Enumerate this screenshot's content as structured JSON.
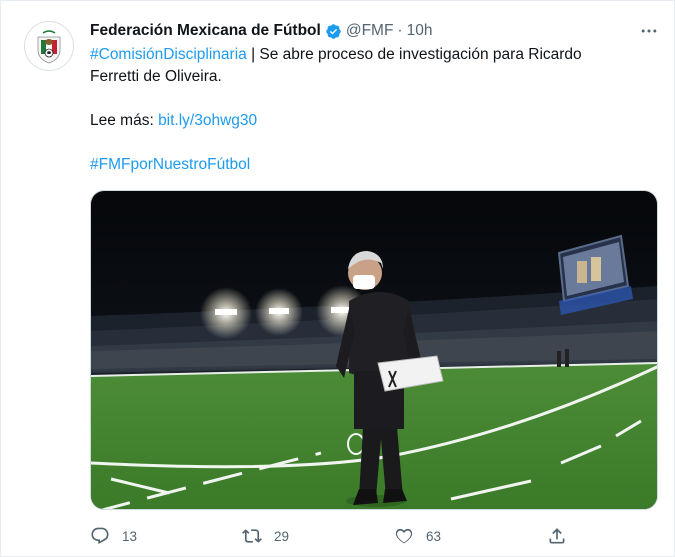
{
  "tweet": {
    "author_name": "Federación Mexicana de Fútbol",
    "handle": "@FMF",
    "separator": "·",
    "time": "10h",
    "text": {
      "hashtag1": "#ComisiónDisciplinaria",
      "line1_rest": " | Se abre proceso de investigación para Ricardo",
      "line2": "Ferretti de Oliveira.",
      "read_more_label": "Lee más: ",
      "link": "bit.ly/3ohwg30",
      "hashtag2": "#FMFporNuestroFútbol"
    },
    "media_description": "Coach in mask walking on the field in a stadium at night"
  },
  "actions": {
    "reply_count": "13",
    "retweet_count": "29",
    "like_count": "63"
  },
  "icons": {
    "verified": "verified-badge-icon",
    "more": "more-options-icon",
    "reply": "reply-icon",
    "retweet": "retweet-icon",
    "like": "heart-icon",
    "share": "share-icon"
  },
  "colors": {
    "accent": "#1d9bf0",
    "text": "#0f1419",
    "secondary": "#536471",
    "border": "#cfd9de"
  }
}
